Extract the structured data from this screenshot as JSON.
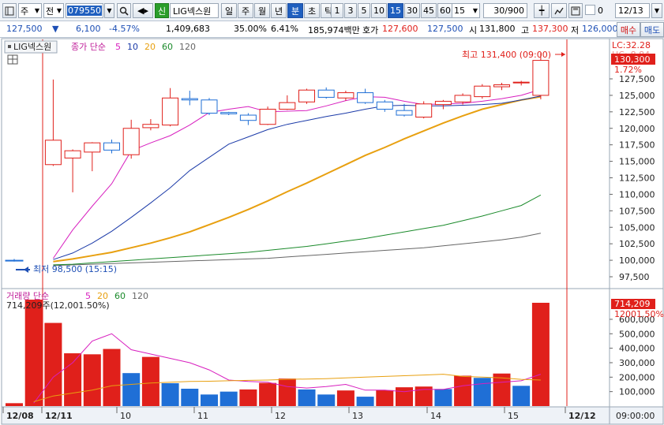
{
  "toolbar": {
    "market": "주",
    "period_mode": "전",
    "code": "079550",
    "badge": "신",
    "stock_name": "LIG넥스원",
    "periods": [
      "일",
      "주",
      "월",
      "년",
      "분",
      "초",
      "틱"
    ],
    "active_period": "분",
    "intervals": [
      "1",
      "3",
      "5",
      "10",
      "15",
      "30",
      "45",
      "60"
    ],
    "active_interval": "15",
    "interval_select": "15",
    "count": "30/900",
    "check_label": "0",
    "date": "12/13"
  },
  "quote": {
    "price": "127,500",
    "change_arrow": "▼",
    "change": "6,100",
    "change_pct": "-4.57%",
    "volume": "1,409,683",
    "ratio1": "35.00%",
    "ratio2": "6.41%",
    "amount": "185,974백만",
    "ask_label": "호가",
    "ask": "127,600",
    "bid": "127,500",
    "open_label": "시",
    "open": "131,800",
    "high_label": "고",
    "high": "137,300",
    "low_label": "저",
    "low": "126,000",
    "buy": "매수",
    "sell": "매도"
  },
  "price_panel": {
    "legend_name": "LIG넥스원",
    "legend_ma_title": "종가 단순",
    "legend_ma": [
      "5",
      "10",
      "20",
      "60",
      "120"
    ],
    "ma_colors": [
      "#d81fbf",
      "#1b3aa8",
      "#e8a010",
      "#1a8a2a",
      "#666666"
    ],
    "lc": "LC:32.28",
    "hc": "HC:-8.84",
    "last_price": "130,300",
    "last_pct": "1.72%",
    "max_label": "최고 131,400 (09:00)",
    "min_label": "최저 98,500 (15:15)",
    "y_ticks": [
      "127,500",
      "125,000",
      "122,500",
      "120,000",
      "117,500",
      "115,000",
      "112,500",
      "110,000",
      "107,500",
      "105,000",
      "102,500",
      "100,000",
      "97,500"
    ]
  },
  "volume_panel": {
    "legend_title": "거래량",
    "legend_ma_title": "단순",
    "legend_ma": [
      "5",
      "20",
      "60",
      "120"
    ],
    "info": "714,209주(12,001.50%)",
    "last_vol": "714,209",
    "last_pct": "12001.50%",
    "y_ticks": [
      "600,000",
      "500,000",
      "400,000",
      "300,000",
      "200,000",
      "100,000"
    ]
  },
  "x_axis": {
    "labels": [
      "12/08",
      "12/11",
      "10",
      "11",
      "12",
      "13",
      "14",
      "15",
      "12/12"
    ],
    "time": "09:00:00"
  },
  "colors": {
    "up": "#e0201b",
    "down": "#1f6fd6"
  },
  "chart_data": {
    "type": "candlestick",
    "candles": [
      {
        "o": 100000,
        "h": 100200,
        "l": 99800,
        "c": 99900
      },
      {
        "o": 114500,
        "h": 127400,
        "l": 114300,
        "c": 118200
      },
      {
        "o": 115500,
        "h": 116800,
        "l": 110300,
        "c": 116600
      },
      {
        "o": 116400,
        "h": 117900,
        "l": 113500,
        "c": 117800
      },
      {
        "o": 117800,
        "h": 118300,
        "l": 116200,
        "c": 116700
      },
      {
        "o": 116000,
        "h": 121300,
        "l": 115400,
        "c": 120000
      },
      {
        "o": 120100,
        "h": 121400,
        "l": 119700,
        "c": 120600
      },
      {
        "o": 120500,
        "h": 126100,
        "l": 120300,
        "c": 124600
      },
      {
        "o": 124500,
        "h": 125700,
        "l": 123500,
        "c": 124300
      },
      {
        "o": 124300,
        "h": 124600,
        "l": 122000,
        "c": 122300
      },
      {
        "o": 122400,
        "h": 122500,
        "l": 122000,
        "c": 122200
      },
      {
        "o": 122000,
        "h": 122300,
        "l": 120500,
        "c": 121200
      },
      {
        "o": 120600,
        "h": 123300,
        "l": 120500,
        "c": 122900
      },
      {
        "o": 122900,
        "h": 125000,
        "l": 122800,
        "c": 123900
      },
      {
        "o": 124000,
        "h": 126000,
        "l": 123700,
        "c": 125800
      },
      {
        "o": 125800,
        "h": 126200,
        "l": 124500,
        "c": 124700
      },
      {
        "o": 124600,
        "h": 125700,
        "l": 124200,
        "c": 125400
      },
      {
        "o": 125400,
        "h": 126000,
        "l": 123700,
        "c": 123900
      },
      {
        "o": 124000,
        "h": 124300,
        "l": 122500,
        "c": 122900
      },
      {
        "o": 122700,
        "h": 123700,
        "l": 121800,
        "c": 122000
      },
      {
        "o": 121700,
        "h": 124100,
        "l": 121500,
        "c": 123700
      },
      {
        "o": 123600,
        "h": 124300,
        "l": 122900,
        "c": 124100
      },
      {
        "o": 124000,
        "h": 125300,
        "l": 123600,
        "c": 125000
      },
      {
        "o": 124800,
        "h": 126700,
        "l": 124500,
        "c": 126400
      },
      {
        "o": 126300,
        "h": 126900,
        "l": 125800,
        "c": 126600
      },
      {
        "o": 126900,
        "h": 127200,
        "l": 126500,
        "c": 127000
      },
      {
        "o": 125000,
        "h": 131400,
        "l": 124400,
        "c": 130300
      }
    ],
    "ma5": [
      null,
      100300,
      104600,
      108200,
      111600,
      116600,
      117800,
      118900,
      120500,
      122400,
      122900,
      123300,
      122500,
      122600,
      122700,
      123400,
      124200,
      124800,
      124700,
      124100,
      123600,
      123700,
      123800,
      124100,
      124500,
      125000,
      125900
    ],
    "ma10": [
      null,
      100100,
      101100,
      102600,
      104400,
      106500,
      108700,
      111000,
      113600,
      115600,
      117600,
      118700,
      119800,
      120600,
      121200,
      121800,
      122300,
      122900,
      123400,
      123500,
      123400,
      123400,
      123500,
      123600,
      123800,
      124300,
      124900
    ],
    "ma20": [
      null,
      99800,
      100200,
      100700,
      101200,
      101900,
      102600,
      103400,
      104300,
      105400,
      106500,
      107700,
      109000,
      110400,
      111700,
      113100,
      114500,
      115900,
      117100,
      118400,
      119600,
      120800,
      121900,
      122900,
      123600,
      124300,
      124800
    ],
    "ma60": [
      null,
      99300,
      99400,
      99600,
      99800,
      100000,
      100200,
      100400,
      100600,
      100800,
      101000,
      101200,
      101500,
      101800,
      102100,
      102500,
      102900,
      103300,
      103800,
      104300,
      104800,
      105300,
      106000,
      106700,
      107500,
      108300,
      109900
    ],
    "ma120": [
      null,
      99200,
      99300,
      99400,
      99500,
      99600,
      99700,
      99800,
      99900,
      100000,
      100100,
      100200,
      100300,
      100500,
      100700,
      100900,
      101100,
      101300,
      101500,
      101700,
      101900,
      102200,
      102500,
      102800,
      103100,
      103500,
      104100
    ],
    "volume": [
      20000,
      850000,
      575000,
      365000,
      358000,
      395000,
      228000,
      340000,
      158000,
      120000,
      80000,
      100000,
      115000,
      160000,
      190000,
      115000,
      80000,
      108000,
      65000,
      110000,
      130000,
      135000,
      118000,
      210000,
      195000,
      225000,
      140000,
      714209
    ],
    "vol_up": [
      true,
      true,
      true,
      true,
      true,
      true,
      false,
      true,
      false,
      false,
      false,
      false,
      true,
      true,
      true,
      false,
      false,
      true,
      false,
      true,
      true,
      true,
      false,
      true,
      false,
      true,
      false,
      true
    ],
    "vol_ma5": [
      null,
      20000,
      200000,
      300000,
      450000,
      500000,
      390000,
      360000,
      330000,
      300000,
      250000,
      180000,
      170000,
      165000,
      135000,
      125000,
      135000,
      150000,
      110000,
      110000,
      100000,
      115000,
      115000,
      140000,
      155000,
      165000,
      175000,
      220000
    ],
    "vol_ma20": [
      null,
      30000,
      70000,
      90000,
      110000,
      140000,
      150000,
      160000,
      165000,
      170000,
      172000,
      175000,
      178000,
      180000,
      185000,
      187000,
      190000,
      195000,
      200000,
      205000,
      210000,
      215000,
      220000,
      205000,
      200000,
      195000,
      185000,
      180000
    ]
  }
}
